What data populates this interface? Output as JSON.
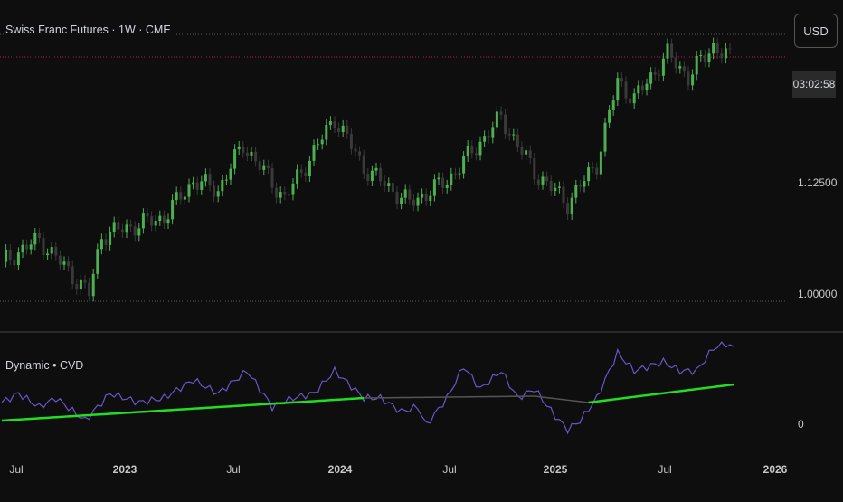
{
  "header": {
    "title": "Swiss Franc Futures · 1W · CME",
    "currency": "USD",
    "countdown": "03:02:58"
  },
  "price_axis": {
    "labels": [
      {
        "text": "1.12500",
        "value": 1.125
      },
      {
        "text": "1.00000",
        "value": 1.0
      }
    ]
  },
  "indicator": {
    "label": "Dynamic • CVD",
    "zero_label": "0"
  },
  "time_axis": {
    "labels": [
      {
        "text": "Jul",
        "bold": false
      },
      {
        "text": "2023",
        "bold": true
      },
      {
        "text": "Jul",
        "bold": false
      },
      {
        "text": "2024",
        "bold": true
      },
      {
        "text": "Jul",
        "bold": false
      },
      {
        "text": "2025",
        "bold": true
      },
      {
        "text": "Jul",
        "bold": false
      },
      {
        "text": "2026",
        "bold": true
      }
    ]
  },
  "colors": {
    "up": "#4caf50",
    "down": "#3a3a3a",
    "cvd": "#6a55c8",
    "cvd_ma": "#22dd22",
    "cvd_ma_flat": "#555555",
    "last_price_line": "#c2185b"
  },
  "chart_data": {
    "type": "candlestick",
    "timeframe": "1W",
    "price_anchors": [
      [
        0,
        1.037
      ],
      [
        9,
        1.062
      ],
      [
        21,
        1.001
      ],
      [
        24,
        1.067
      ],
      [
        39,
        1.087
      ],
      [
        46,
        1.128
      ],
      [
        52,
        1.118
      ],
      [
        58,
        1.169
      ],
      [
        68,
        1.108
      ],
      [
        80,
        1.199
      ],
      [
        87,
        1.143
      ],
      [
        98,
        1.103
      ],
      [
        107,
        1.128
      ],
      [
        120,
        1.199
      ],
      [
        128,
        1.138
      ],
      [
        136,
        1.103
      ],
      [
        143,
        1.148
      ],
      [
        148,
        1.24
      ],
      [
        152,
        1.22
      ],
      [
        160,
        1.27
      ],
      [
        165,
        1.245
      ],
      [
        171,
        1.28
      ],
      [
        175,
        1.265
      ]
    ],
    "ylim": [
      0.97,
      1.3
    ],
    "cvd_anchors": [
      [
        0,
        25
      ],
      [
        4,
        35
      ],
      [
        9,
        20
      ],
      [
        13,
        30
      ],
      [
        20,
        5
      ],
      [
        26,
        35
      ],
      [
        33,
        25
      ],
      [
        39,
        30
      ],
      [
        46,
        50
      ],
      [
        52,
        35
      ],
      [
        59,
        60
      ],
      [
        65,
        20
      ],
      [
        70,
        30
      ],
      [
        75,
        35
      ],
      [
        80,
        60
      ],
      [
        87,
        30
      ],
      [
        91,
        30
      ],
      [
        96,
        15
      ],
      [
        100,
        20
      ],
      [
        102,
        0
      ],
      [
        107,
        30
      ],
      [
        111,
        65
      ],
      [
        115,
        40
      ],
      [
        120,
        60
      ],
      [
        124,
        30
      ],
      [
        128,
        40
      ],
      [
        133,
        10
      ],
      [
        136,
        -5
      ],
      [
        139,
        5
      ],
      [
        143,
        30
      ],
      [
        148,
        80
      ],
      [
        152,
        60
      ],
      [
        159,
        70
      ],
      [
        163,
        60
      ],
      [
        167,
        60
      ],
      [
        171,
        85
      ],
      [
        174,
        90
      ],
      [
        176,
        85
      ]
    ],
    "cvd_ma_anchors": [
      [
        0,
        5
      ],
      [
        87,
        30
      ],
      [
        128,
        32
      ],
      [
        141,
        25
      ],
      [
        176,
        45
      ]
    ],
    "cvd_ylim": [
      -15,
      100
    ]
  }
}
